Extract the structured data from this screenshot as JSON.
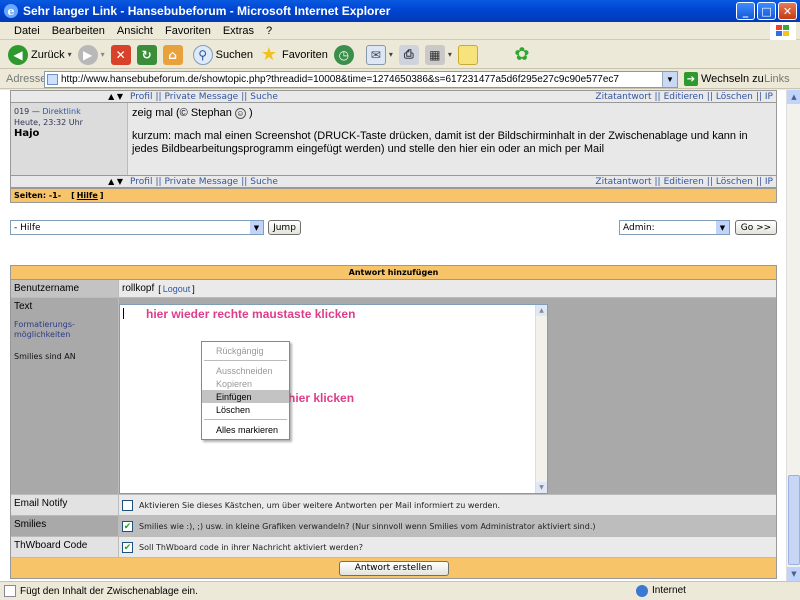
{
  "window": {
    "title": "Sehr langer Link - Hansebubeforum - Microsoft Internet Explorer",
    "min": "_",
    "max": "□",
    "close": "✕"
  },
  "menu": [
    "Datei",
    "Bearbeiten",
    "Ansicht",
    "Favoriten",
    "Extras",
    "?"
  ],
  "toolbar": {
    "back": "Zurück",
    "search": "Suchen",
    "favorites": "Favoriten"
  },
  "address": {
    "label": "Adresse",
    "url": "http://www.hansebubeforum.de/showtopic.php?threadid=10008&time=1274650386&s=617231477a5d6f295e27c9c90e577ec7",
    "go": "Wechseln zu",
    "links": "Links"
  },
  "post": {
    "top_bar": {
      "left": [
        "Profil",
        "||",
        "Private Message",
        "||",
        "Suche"
      ],
      "right": [
        "Zitatantwort",
        "||",
        "Editieren",
        "||",
        "Löschen",
        "||",
        "IP"
      ]
    },
    "number": "019",
    "direktlink": "Direktlink",
    "date": "Heute, 23:32 Uhr",
    "author": "Hajo",
    "message1": "zeig mal (© Stephan",
    "message1_end": ")",
    "message2": "kurzum: mach mal einen Screenshot (DRUCK-Taste drücken, damit ist der Bildschirminhalt in der Zwischenablage und kann in jedes Bildbearbeitungsprogramm eingefügt werden) und stelle den hier ein oder an mich per Mail"
  },
  "pages": {
    "label": "Seiten: -1-",
    "bracket_open": "[",
    "help": "Hilfe",
    "bracket_close": "]"
  },
  "jump": {
    "select_value": "- Hilfe",
    "jump_button": "Jump",
    "admin_value": "Admin:",
    "go_button": "Go >>"
  },
  "reply": {
    "header": "Antwort hinzufügen",
    "username_label": "Benutzername",
    "username": "rollkopf",
    "logout_open": "[",
    "logout": "Logout",
    "logout_close": "]",
    "text_label": "Text",
    "format_link": "Formatierungs-möglichkeiten",
    "smilies_on": "Smilies sind AN",
    "email_label": "Email Notify",
    "email_text": "Aktivieren Sie dieses Kästchen, um über weitere Antworten per Mail informiert zu werden.",
    "smilies_label": "Smilies",
    "smilies_text": "Smilies wie :), ;) usw. in kleine Grafiken verwandeln? (Nur sinnvoll wenn Smilies vom Administrator aktiviert sind.)",
    "code_label": "ThWboard Code",
    "code_text": "Soll ThWboard code in ihrer Nachricht aktiviert werden?",
    "submit": "Antwort erstellen"
  },
  "annotations": {
    "hint1": "hier wieder rechte maustaste klicken",
    "hint2": "dann hier klicken",
    "hint_color": "#e03c8c"
  },
  "context_menu": {
    "undo": "Rückgängig",
    "cut": "Ausschneiden",
    "copy": "Kopieren",
    "paste": "Einfügen",
    "delete": "Löschen",
    "select_all": "Alles markieren"
  },
  "status": {
    "text": "Fügt den Inhalt der Zwischenablage ein.",
    "zone": "Internet"
  }
}
